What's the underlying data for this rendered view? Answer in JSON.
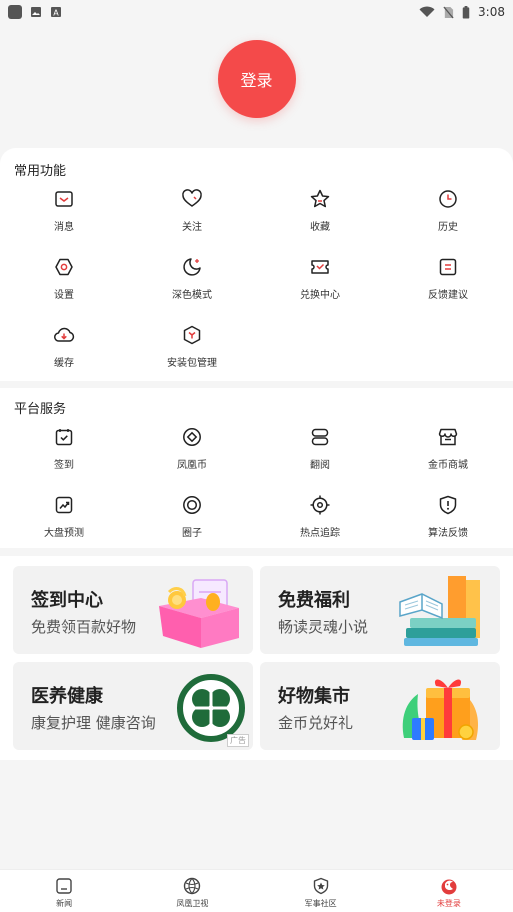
{
  "status_bar": {
    "time": "3:08",
    "notif_icon": "A"
  },
  "login": {
    "label": "登录"
  },
  "common": {
    "title": "常用功能",
    "items": [
      {
        "label": "消息",
        "icon": "message-icon"
      },
      {
        "label": "关注",
        "icon": "heart-icon"
      },
      {
        "label": "收藏",
        "icon": "star-icon"
      },
      {
        "label": "历史",
        "icon": "clock-icon"
      },
      {
        "label": "设置",
        "icon": "gear-icon"
      },
      {
        "label": "深色模式",
        "icon": "moon-icon"
      },
      {
        "label": "兑换中心",
        "icon": "ticket-icon"
      },
      {
        "label": "反馈建议",
        "icon": "feedback-icon"
      },
      {
        "label": "缓存",
        "icon": "cloud-download-icon"
      },
      {
        "label": "安装包管理",
        "icon": "package-icon"
      }
    ]
  },
  "platform": {
    "title": "平台服务",
    "items": [
      {
        "label": "签到",
        "icon": "checkin-icon"
      },
      {
        "label": "凤凰币",
        "icon": "coin-icon"
      },
      {
        "label": "翻阅",
        "icon": "book-icon"
      },
      {
        "label": "金币商城",
        "icon": "store-icon"
      },
      {
        "label": "大盘预测",
        "icon": "trend-icon"
      },
      {
        "label": "圈子",
        "icon": "circle-icon"
      },
      {
        "label": "热点追踪",
        "icon": "target-icon"
      },
      {
        "label": "算法反馈",
        "icon": "shield-alert-icon"
      }
    ]
  },
  "promos": [
    {
      "title": "签到中心",
      "subtitle": "免费领百款好物"
    },
    {
      "title": "免费福利",
      "subtitle": "畅读灵魂小说"
    },
    {
      "title": "医养健康",
      "subtitle": "康复护理 健康咨询",
      "ad": "广告"
    },
    {
      "title": "好物集市",
      "subtitle": "金币兑好礼"
    }
  ],
  "tabs": [
    {
      "label": "新闻",
      "icon": "news-icon"
    },
    {
      "label": "凤凰卫视",
      "icon": "phoenix-icon"
    },
    {
      "label": "军事社区",
      "icon": "military-star-icon"
    },
    {
      "label": "未登录",
      "icon": "user-phoenix-icon",
      "active": true
    }
  ],
  "colors": {
    "accent": "#f44a4a",
    "icon_red": "#e23c3c"
  }
}
